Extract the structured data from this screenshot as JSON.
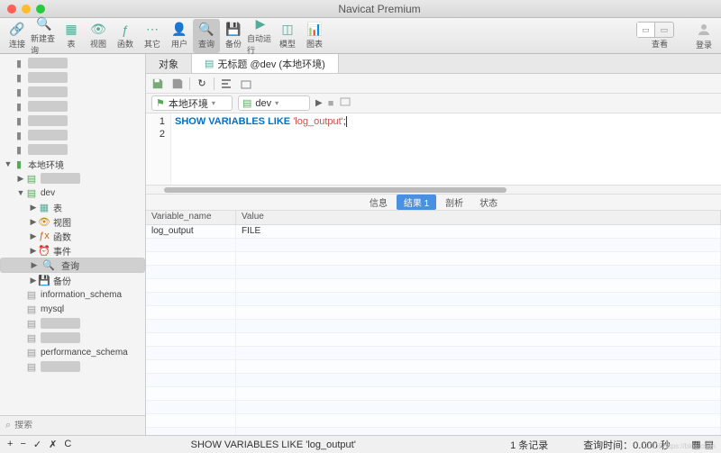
{
  "window": {
    "title": "Navicat Premium"
  },
  "toolbar": {
    "items": [
      "连接",
      "新建查询",
      "表",
      "视图",
      "函数",
      "其它",
      "用户",
      "查询",
      "备份",
      "自动运行",
      "模型",
      "图表"
    ],
    "view_label": "查看",
    "login_label": "登录"
  },
  "sidebar": {
    "search_placeholder": "搜索",
    "nodes": [
      {
        "indent": 0,
        "arrow": "",
        "icon": "conn",
        "label": "",
        "blur": true
      },
      {
        "indent": 0,
        "arrow": "",
        "icon": "conn",
        "label": "",
        "blur": true
      },
      {
        "indent": 0,
        "arrow": "",
        "icon": "conn",
        "label": "",
        "blur": true
      },
      {
        "indent": 0,
        "arrow": "",
        "icon": "conn",
        "label": "",
        "blur": true
      },
      {
        "indent": 0,
        "arrow": "",
        "icon": "conn",
        "label": "",
        "blur": true
      },
      {
        "indent": 0,
        "arrow": "",
        "icon": "conn",
        "label": "",
        "blur": true
      },
      {
        "indent": 0,
        "arrow": "",
        "icon": "conn",
        "label": "",
        "blur": true
      },
      {
        "indent": 0,
        "arrow": "▼",
        "icon": "conn-g",
        "label": "本地环境"
      },
      {
        "indent": 1,
        "arrow": "▶",
        "icon": "db",
        "label": "",
        "blur": true
      },
      {
        "indent": 1,
        "arrow": "▼",
        "icon": "db",
        "label": "dev"
      },
      {
        "indent": 2,
        "arrow": "▶",
        "icon": "table",
        "label": "表"
      },
      {
        "indent": 2,
        "arrow": "▶",
        "icon": "view",
        "label": "视图"
      },
      {
        "indent": 2,
        "arrow": "▶",
        "icon": "fn",
        "label": "函数"
      },
      {
        "indent": 2,
        "arrow": "▶",
        "icon": "event",
        "label": "事件"
      },
      {
        "indent": 2,
        "arrow": "▶",
        "icon": "query",
        "label": "查询",
        "selected": true
      },
      {
        "indent": 2,
        "arrow": "▶",
        "icon": "backup",
        "label": "备份"
      },
      {
        "indent": 1,
        "arrow": "",
        "icon": "db-g",
        "label": "information_schema"
      },
      {
        "indent": 1,
        "arrow": "",
        "icon": "db-g",
        "label": "mysql"
      },
      {
        "indent": 1,
        "arrow": "",
        "icon": "db-g",
        "label": "",
        "blur": true
      },
      {
        "indent": 1,
        "arrow": "",
        "icon": "db-g",
        "label": "",
        "blur": true
      },
      {
        "indent": 1,
        "arrow": "",
        "icon": "db-g",
        "label": "performance_schema"
      },
      {
        "indent": 1,
        "arrow": "",
        "icon": "db-g",
        "label": "",
        "blur": true
      }
    ]
  },
  "tabs": [
    {
      "label": "对象",
      "active": false
    },
    {
      "label": "无标题 @dev (本地环境)",
      "active": true
    }
  ],
  "connbar": {
    "conn": "本地环境",
    "db": "dev"
  },
  "editor": {
    "lines": [
      "1",
      "2"
    ],
    "sql_kw1": "SHOW VARIABLES LIKE ",
    "sql_str": "'log_output'",
    "sql_end": ";"
  },
  "result_tabs": [
    "信息",
    "结果 1",
    "剖析",
    "状态"
  ],
  "result_active": 1,
  "results": {
    "headers": [
      "Variable_name",
      "Value"
    ],
    "rows": [
      [
        "log_output",
        "FILE"
      ]
    ]
  },
  "status": {
    "query": "SHOW VARIABLES LIKE 'log_output'",
    "records": "1 条记录",
    "time": "查询时间：0.000 秒"
  }
}
